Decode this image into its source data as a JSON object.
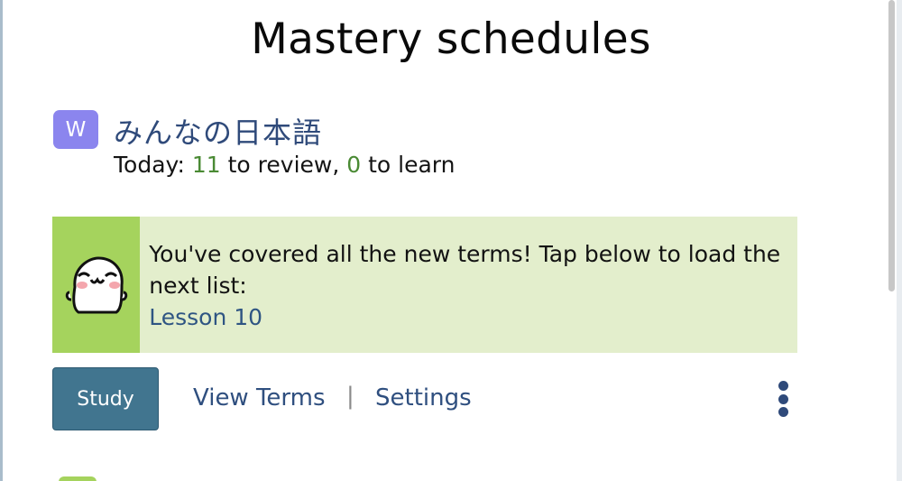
{
  "page": {
    "title": "Mastery schedules"
  },
  "course": {
    "icon_letter": "W",
    "icon_color": "#8b85ee",
    "title": "みんなの日本語",
    "status_prefix": "Today:",
    "review_count": "11",
    "review_label": "to review,",
    "learn_count": "0",
    "learn_label": "to learn"
  },
  "notice": {
    "message": "You've covered all the new terms! Tap below to load the next list:",
    "link_label": "Lesson 10",
    "mascot": "smiling-mascot-icon",
    "background_color": "#e3eecc",
    "accent_color": "#a5d35d"
  },
  "actions": {
    "study_label": "Study",
    "view_terms_label": "View Terms",
    "separator": "|",
    "settings_label": "Settings",
    "more_icon": "more-vertical-icon"
  },
  "colors": {
    "study_button": "#41758f",
    "link": "#2f4f7f",
    "count": "#4a8a34"
  }
}
